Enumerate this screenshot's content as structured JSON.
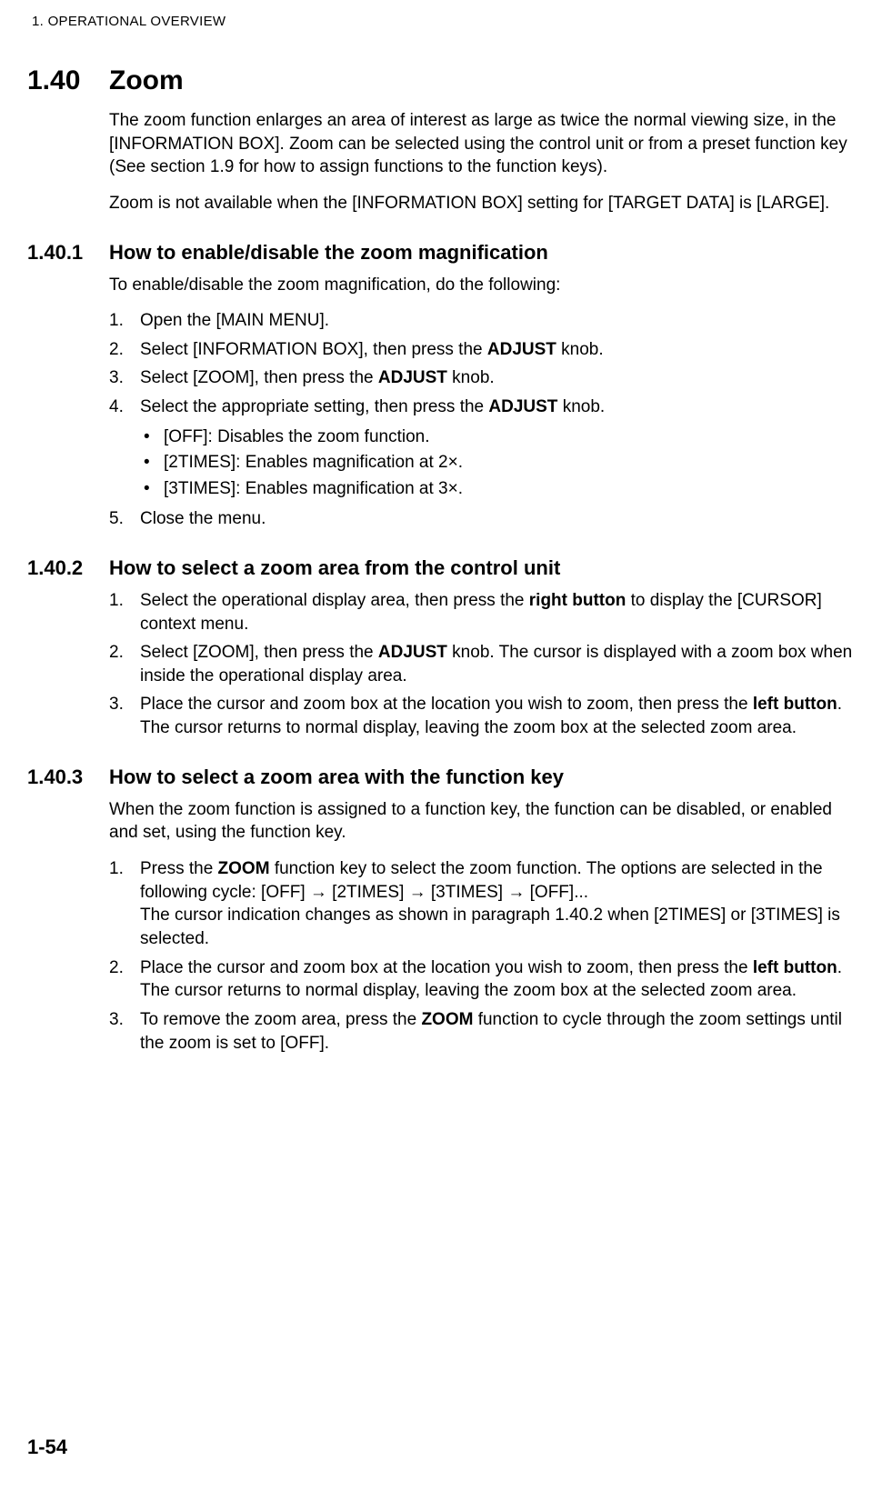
{
  "header": "1.  OPERATIONAL OVERVIEW",
  "section": {
    "number": "1.40",
    "title": "Zoom",
    "intro1": "The zoom function enlarges an area of interest as large as twice the normal viewing size, in the [INFORMATION BOX]. Zoom can be selected using the control unit or from a preset function key (See section 1.9 for how to assign functions to the function keys).",
    "intro2": "Zoom is not available when the [INFORMATION BOX] setting for [TARGET DATA] is [LARGE]."
  },
  "sub1": {
    "number": "1.40.1",
    "title": "How to enable/disable the zoom magnification",
    "intro": "To enable/disable the zoom magnification, do the following:",
    "step1": "Open the [MAIN MENU].",
    "step2a": "Select [INFORMATION BOX], then press the ",
    "step2b": "ADJUST",
    "step2c": " knob.",
    "step3a": "Select [ZOOM], then press the ",
    "step3b": "ADJUST",
    "step3c": " knob.",
    "step4a": "Select the appropriate setting, then press the ",
    "step4b": "ADJUST",
    "step4c": " knob.",
    "bullet1": "[OFF]: Disables the zoom function.",
    "bullet2": "[2TIMES]: Enables magnification at 2×.",
    "bullet3": "[3TIMES]: Enables magnification at 3×.",
    "step5": "Close the menu."
  },
  "sub2": {
    "number": "1.40.2",
    "title": "How to select a zoom area from the control unit",
    "step1a": "Select the operational display area, then press the ",
    "step1b": "right button",
    "step1c": " to display the [CURSOR] context menu.",
    "step2a": "Select [ZOOM], then press the ",
    "step2b": "ADJUST",
    "step2c": " knob. The cursor is displayed with a zoom box when inside the operational display area.",
    "step3a": "Place the cursor and zoom box at the location you wish to zoom, then press the ",
    "step3b": "left button",
    "step3c": ". The cursor returns to normal display, leaving the zoom box at the selected zoom area."
  },
  "sub3": {
    "number": "1.40.3",
    "title": "How to select a zoom area with the function key",
    "intro": "When the zoom function is assigned to a function key, the function can be disabled, or enabled and set, using the function key.",
    "step1a": "Press the ",
    "step1b": "ZOOM",
    "step1c": " function key to select the zoom function. The options are selected in the following cycle: [OFF] → [2TIMES] → [3TIMES] → [OFF]...",
    "step1d": "The cursor indication changes as shown in paragraph 1.40.2 when [2TIMES] or [3TIMES] is selected.",
    "step2a": "Place the cursor and zoom box at the location you wish to zoom, then press the ",
    "step2b": "left button",
    "step2c": ". The cursor returns to normal display, leaving the zoom box at the selected zoom area.",
    "step3a": "To remove the zoom area, press the ",
    "step3b": "ZOOM",
    "step3c": " function to cycle through the zoom settings until the zoom is set to [OFF]."
  },
  "pageNumber": "1-54"
}
